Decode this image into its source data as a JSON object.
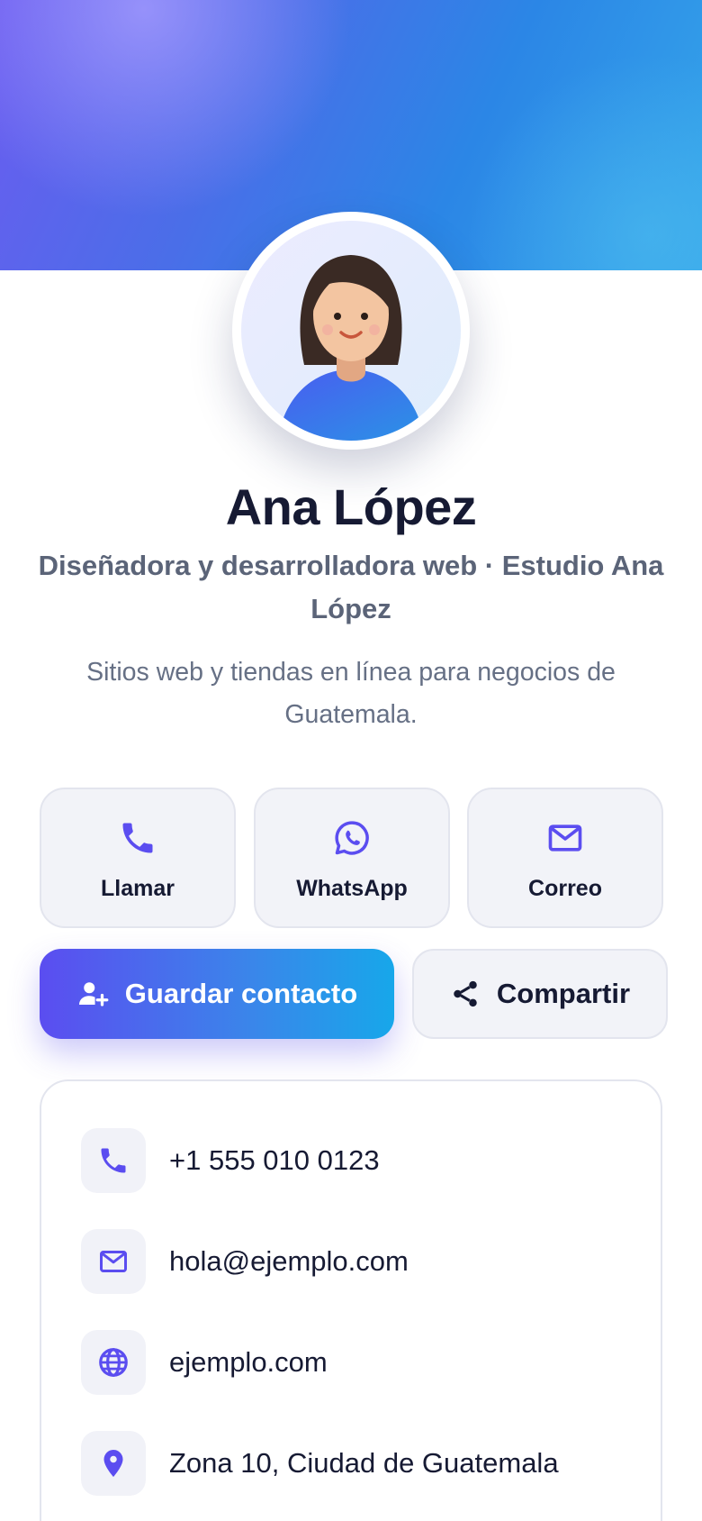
{
  "profile": {
    "name": "Ana López",
    "role": "Diseñadora y desarrolladora web · Estudio Ana López",
    "tagline": "Sitios web y tiendas en línea para negocios de Guatemala."
  },
  "actions": [
    {
      "label": "Llamar",
      "icon": "phone-icon"
    },
    {
      "label": "WhatsApp",
      "icon": "whatsapp-icon"
    },
    {
      "label": "Correo",
      "icon": "mail-icon"
    }
  ],
  "buttons": {
    "save_label": "Guardar contacto",
    "share_label": "Compartir"
  },
  "contact": [
    {
      "icon": "phone-icon",
      "value": "+1 555 010 0123"
    },
    {
      "icon": "mail-icon",
      "value": "hola@ejemplo.com"
    },
    {
      "icon": "globe-icon",
      "value": "ejemplo.com"
    },
    {
      "icon": "location-pin-icon",
      "value": "Zona 10, Ciudad de Guatemala"
    }
  ],
  "colors": {
    "accent": "#5b4df0",
    "accent_gradient_end": "#17a7ea",
    "text_dark": "#161a33",
    "text_muted": "#5b6478"
  }
}
